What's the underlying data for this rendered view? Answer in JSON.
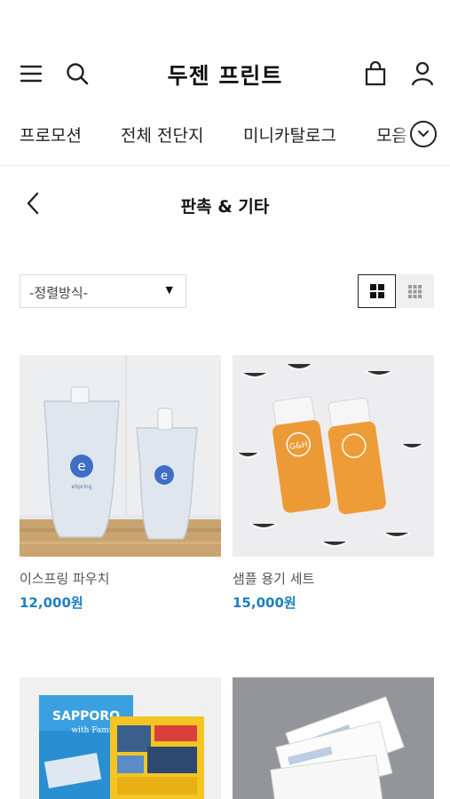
{
  "header": {
    "brand": "두젠 프린트",
    "icons": [
      "menu-icon",
      "search-icon",
      "shopping-bag-icon",
      "user-icon"
    ]
  },
  "categories": [
    {
      "label": "프로모션"
    },
    {
      "label": "전체 전단지"
    },
    {
      "label": "미니카탈로그"
    },
    {
      "label": "모음"
    }
  ],
  "page": {
    "title": "판촉 & 기타"
  },
  "sort": {
    "label": "-정렬방식-",
    "caret": "▼"
  },
  "products": [
    {
      "name": "이스프링 파우치",
      "price": "12,000원",
      "bottle_text": "eSpring"
    },
    {
      "name": "샘플 용기 세트",
      "price": "15,000원",
      "bottle_text": "G&H"
    },
    {
      "name": "",
      "price": "",
      "cover_text": "SAPPORO",
      "cover_sub": "with Family"
    },
    {
      "name": "",
      "price": "",
      "cover_text": ""
    }
  ],
  "colors": {
    "accent_price": "#1f7fc1",
    "text": "#222222"
  }
}
